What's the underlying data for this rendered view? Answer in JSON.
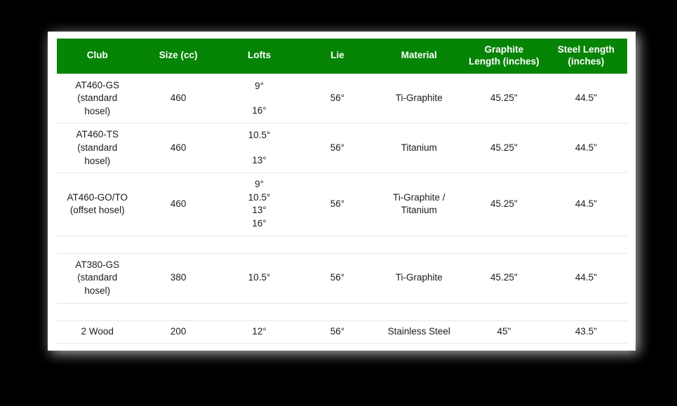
{
  "table": {
    "columns": [
      {
        "key": "club",
        "label": "Club"
      },
      {
        "key": "size",
        "label": "Size (cc)"
      },
      {
        "key": "lofts",
        "label": "Lofts"
      },
      {
        "key": "lie",
        "label": "Lie"
      },
      {
        "key": "material",
        "label": "Material"
      },
      {
        "key": "graphite",
        "label": "Graphite Length (inches)"
      },
      {
        "key": "steel",
        "label": "Steel Length (inches)"
      }
    ],
    "header_labels": {
      "club": "Club",
      "size": "Size (cc)",
      "lofts": "Lofts",
      "lie": "Lie",
      "material": "Material",
      "graphite_line1": "Graphite",
      "graphite_line2": "Length (inches)",
      "steel_line1": "Steel Length",
      "steel_line2": "(inches)"
    },
    "rows": [
      {
        "club_line1": "AT460-GS",
        "club_line2": "(standard",
        "club_line3": "hosel)",
        "size": "460",
        "loft1": "9°",
        "loft2": "16°",
        "lie": "56°",
        "material": "Ti-Graphite",
        "graphite": "45.25\"",
        "steel": "44.5\""
      },
      {
        "club_line1": "AT460-TS",
        "club_line2": "(standard",
        "club_line3": "hosel)",
        "size": "460",
        "loft1": "10.5°",
        "loft2": "13°",
        "lie": "56°",
        "material": "Titanium",
        "graphite": "45.25\"",
        "steel": "44.5\""
      },
      {
        "club_line1": "AT460-GO/TO",
        "club_line2": "(offset hosel)",
        "club_line3": "",
        "size": "460",
        "loft1": "9°",
        "loft2": "10.5°",
        "loft3": "13°",
        "loft4": "16°",
        "lie": "56°",
        "material_line1": "Ti-Graphite /",
        "material_line2": "Titanium",
        "graphite": "45.25\"",
        "steel": "44.5\""
      },
      {
        "club_line1": "AT380-GS",
        "club_line2": "(standard",
        "club_line3": "hosel)",
        "size": "380",
        "loft1": "10.5°",
        "lie": "56°",
        "material": "Ti-Graphite",
        "graphite": "45.25\"",
        "steel": "44.5\""
      },
      {
        "club_line1": "2 Wood",
        "size": "200",
        "loft1": "12°",
        "lie": "56°",
        "material": "Stainless Steel",
        "graphite": "45\"",
        "steel": "43.5\""
      }
    ]
  },
  "colors": {
    "header_green": "#068406",
    "header_text": "#ffffff",
    "cell_text": "#1c1c1c",
    "row_divider": "#e6e6e6",
    "panel_background": "#ffffff",
    "page_background": "#000000"
  }
}
